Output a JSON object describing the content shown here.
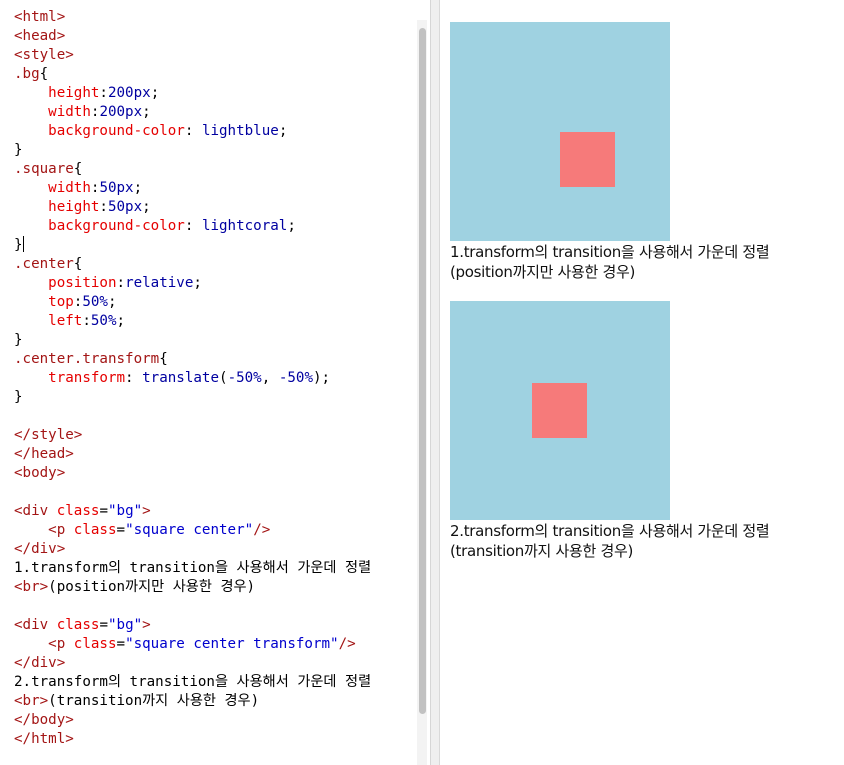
{
  "editor": {
    "lines": [
      [
        [
          "tag",
          "<html>"
        ]
      ],
      [
        [
          "tag",
          "<head>"
        ]
      ],
      [
        [
          "tag",
          "<style>"
        ]
      ],
      [
        [
          "sel",
          ".bg"
        ],
        [
          "pun",
          "{"
        ]
      ],
      [
        [
          "pun",
          "    "
        ],
        [
          "prop",
          "height"
        ],
        [
          "pun",
          ":"
        ],
        [
          "val",
          "200px"
        ],
        [
          "pun",
          ";"
        ]
      ],
      [
        [
          "pun",
          "    "
        ],
        [
          "prop",
          "width"
        ],
        [
          "pun",
          ":"
        ],
        [
          "val",
          "200px"
        ],
        [
          "pun",
          ";"
        ]
      ],
      [
        [
          "pun",
          "    "
        ],
        [
          "prop",
          "background-color"
        ],
        [
          "pun",
          ": "
        ],
        [
          "val",
          "lightblue"
        ],
        [
          "pun",
          ";"
        ]
      ],
      [
        [
          "pun",
          "}"
        ]
      ],
      [
        [
          "sel",
          ".square"
        ],
        [
          "pun",
          "{"
        ]
      ],
      [
        [
          "pun",
          "    "
        ],
        [
          "prop",
          "width"
        ],
        [
          "pun",
          ":"
        ],
        [
          "val",
          "50px"
        ],
        [
          "pun",
          ";"
        ]
      ],
      [
        [
          "pun",
          "    "
        ],
        [
          "prop",
          "height"
        ],
        [
          "pun",
          ":"
        ],
        [
          "val",
          "50px"
        ],
        [
          "pun",
          ";"
        ]
      ],
      [
        [
          "pun",
          "    "
        ],
        [
          "prop",
          "background-color"
        ],
        [
          "pun",
          ": "
        ],
        [
          "val",
          "lightcoral"
        ],
        [
          "pun",
          ";"
        ]
      ],
      [
        [
          "pun",
          "}"
        ],
        [
          "caret",
          ""
        ]
      ],
      [
        [
          "sel",
          ".center"
        ],
        [
          "pun",
          "{"
        ]
      ],
      [
        [
          "pun",
          "    "
        ],
        [
          "prop",
          "position"
        ],
        [
          "pun",
          ":"
        ],
        [
          "val",
          "relative"
        ],
        [
          "pun",
          ";"
        ]
      ],
      [
        [
          "pun",
          "    "
        ],
        [
          "prop",
          "top"
        ],
        [
          "pun",
          ":"
        ],
        [
          "val",
          "50%"
        ],
        [
          "pun",
          ";"
        ]
      ],
      [
        [
          "pun",
          "    "
        ],
        [
          "prop",
          "left"
        ],
        [
          "pun",
          ":"
        ],
        [
          "val",
          "50%"
        ],
        [
          "pun",
          ";"
        ]
      ],
      [
        [
          "pun",
          "}"
        ]
      ],
      [
        [
          "sel",
          ".center.transform"
        ],
        [
          "pun",
          "{"
        ]
      ],
      [
        [
          "pun",
          "    "
        ],
        [
          "prop",
          "transform"
        ],
        [
          "pun",
          ": "
        ],
        [
          "val",
          "translate"
        ],
        [
          "pun",
          "("
        ],
        [
          "val",
          "-50%"
        ],
        [
          "pun",
          ", "
        ],
        [
          "val",
          "-50%"
        ],
        [
          "pun",
          ");"
        ]
      ],
      [
        [
          "pun",
          "}"
        ]
      ],
      [
        [
          "pun",
          ""
        ]
      ],
      [
        [
          "tag",
          "</style>"
        ]
      ],
      [
        [
          "tag",
          "</head>"
        ]
      ],
      [
        [
          "tag",
          "<body>"
        ]
      ],
      [
        [
          "pun",
          ""
        ]
      ],
      [
        [
          "tag",
          "<div "
        ],
        [
          "prop",
          "class"
        ],
        [
          "pun",
          "="
        ],
        [
          "str",
          "\"bg\""
        ],
        [
          "tag",
          ">"
        ]
      ],
      [
        [
          "pun",
          "    "
        ],
        [
          "tag",
          "<p "
        ],
        [
          "prop",
          "class"
        ],
        [
          "pun",
          "="
        ],
        [
          "str",
          "\"square center\""
        ],
        [
          "tag",
          "/>"
        ]
      ],
      [
        [
          "tag",
          "</div>"
        ]
      ],
      [
        [
          "text",
          "1.transform의 transition을 사용해서 가운데 정렬"
        ]
      ],
      [
        [
          "tag",
          "<br>"
        ],
        [
          "text",
          "(position까지만 사용한 경우)"
        ]
      ],
      [
        [
          "pun",
          ""
        ]
      ],
      [
        [
          "tag",
          "<div "
        ],
        [
          "prop",
          "class"
        ],
        [
          "pun",
          "="
        ],
        [
          "str",
          "\"bg\""
        ],
        [
          "tag",
          ">"
        ]
      ],
      [
        [
          "pun",
          "    "
        ],
        [
          "tag",
          "<p "
        ],
        [
          "prop",
          "class"
        ],
        [
          "pun",
          "="
        ],
        [
          "str",
          "\"square center transform\""
        ],
        [
          "tag",
          "/>"
        ]
      ],
      [
        [
          "tag",
          "</div>"
        ]
      ],
      [
        [
          "text",
          "2.transform의 transition을 사용해서 가운데 정렬"
        ]
      ],
      [
        [
          "tag",
          "<br>"
        ],
        [
          "text",
          "(transition까지 사용한 경우)"
        ]
      ],
      [
        [
          "tag",
          "</body>"
        ]
      ],
      [
        [
          "tag",
          "</html>"
        ]
      ]
    ]
  },
  "preview": {
    "example1": {
      "caption_line1": "1.transform의 transition을 사용해서 가운데 정렬",
      "caption_line2": "(position까지만 사용한 경우)"
    },
    "example2": {
      "caption_line1": "2.transform의 transition을 사용해서 가운데 정렬",
      "caption_line2": "(transition까지 사용한 경우)"
    }
  },
  "colors": {
    "box_background": "#9fd2e1",
    "square_color": "#f67a7a",
    "accent": "#21b37a"
  }
}
